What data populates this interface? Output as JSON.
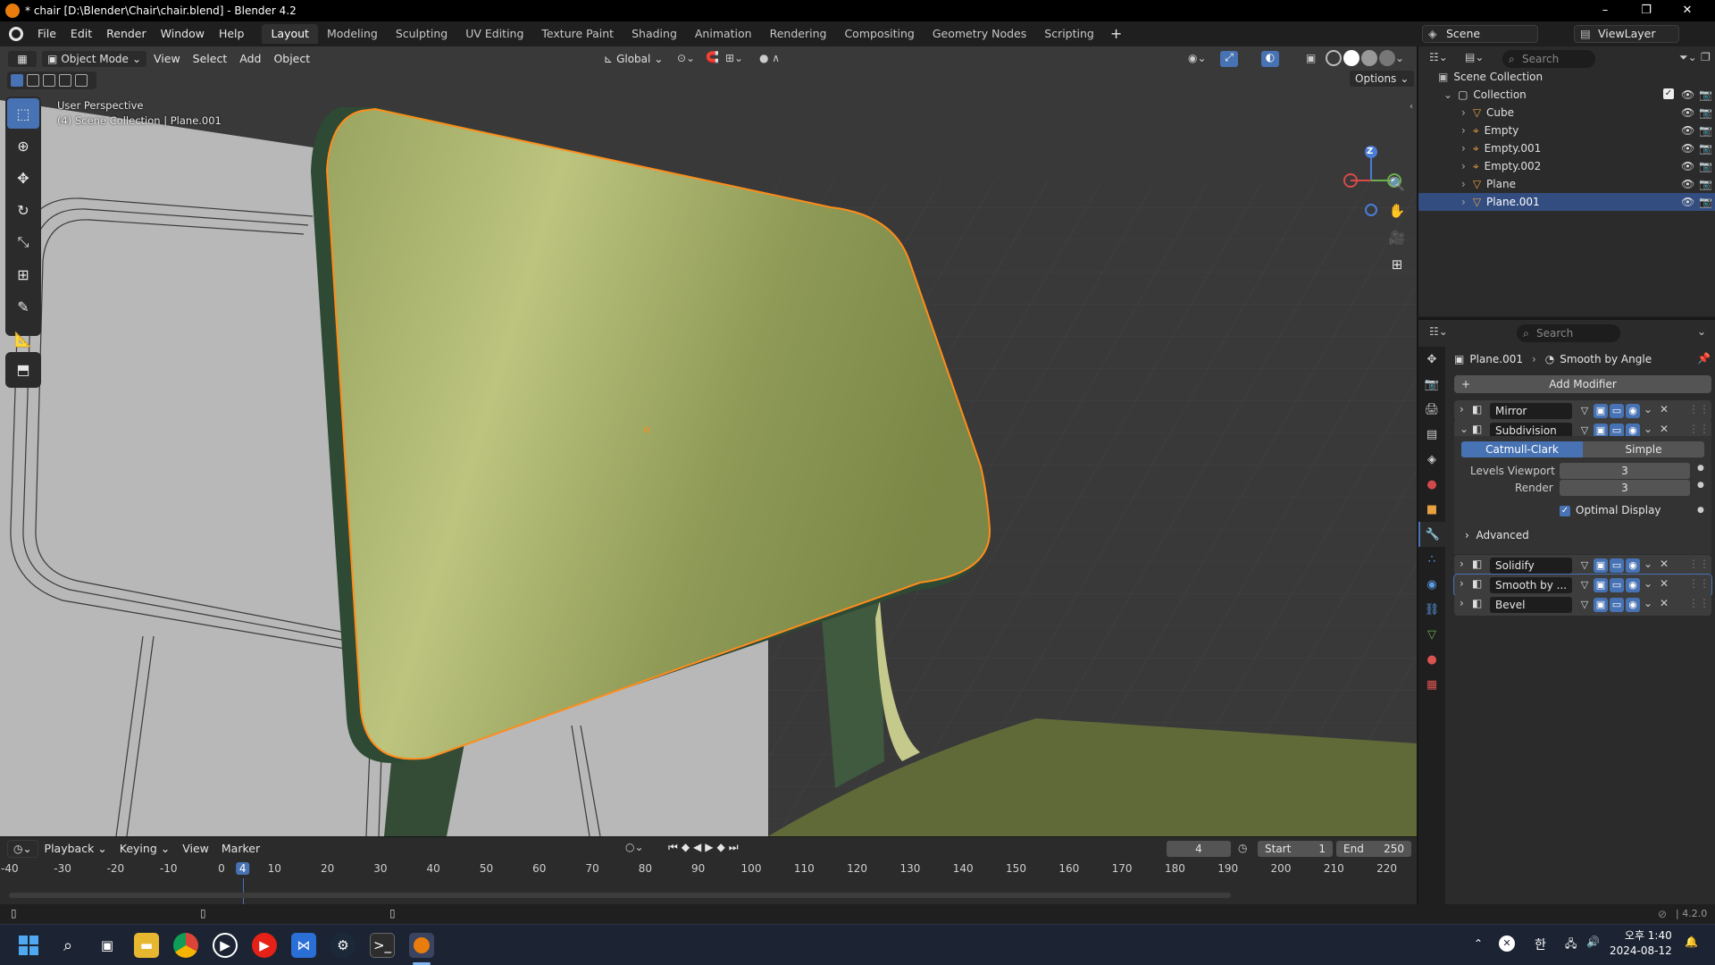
{
  "window": {
    "title": "* chair [D:\\Blender\\Chair\\chair.blend] - Blender 4.2",
    "controls": {
      "minimize": "–",
      "maximize": "❐",
      "close": "✕"
    }
  },
  "menu": [
    "File",
    "Edit",
    "Render",
    "Window",
    "Help"
  ],
  "workspaces": [
    "Layout",
    "Modeling",
    "Sculpting",
    "UV Editing",
    "Texture Paint",
    "Shading",
    "Animation",
    "Rendering",
    "Compositing",
    "Geometry Nodes",
    "Scripting"
  ],
  "active_workspace": "Layout",
  "scene": {
    "name": "Scene",
    "view_layer": "ViewLayer"
  },
  "viewport": {
    "mode": "Object Mode",
    "menus": [
      "View",
      "Select",
      "Add",
      "Object"
    ],
    "orientation": "Global",
    "options_label": "Options",
    "perspective_label": "User Perspective",
    "context_label": "(4) Scene Collection | Plane.001",
    "axis_labels": {
      "z": "Z"
    },
    "tools": [
      "select-box",
      "cursor",
      "move",
      "rotate",
      "scale",
      "transform",
      "annotate",
      "measure",
      "add-cube"
    ],
    "colors": {
      "background": "#393939",
      "seat": "#8c9852",
      "seat_edge": "#ff8c1a",
      "grid": "#4a4a4a"
    }
  },
  "timeline": {
    "menus": [
      "Playback",
      "Keying",
      "View",
      "Marker"
    ],
    "current_frame": "4",
    "start_label": "Start",
    "start": "1",
    "end_label": "End",
    "end": "250",
    "ruler": [
      "-40",
      "-30",
      "-20",
      "-10",
      "0",
      "4",
      "10",
      "20",
      "30",
      "40",
      "50",
      "60",
      "70",
      "80",
      "90",
      "100",
      "110",
      "120",
      "130",
      "140",
      "150",
      "160",
      "170",
      "180",
      "190",
      "200",
      "210",
      "220"
    ]
  },
  "outliner": {
    "search_placeholder": "Search",
    "root": "Scene Collection",
    "collection": "Collection",
    "items": [
      {
        "name": "Cube",
        "type": "mesh"
      },
      {
        "name": "Empty",
        "type": "empty"
      },
      {
        "name": "Empty.001",
        "type": "empty"
      },
      {
        "name": "Empty.002",
        "type": "empty"
      },
      {
        "name": "Plane",
        "type": "mesh"
      },
      {
        "name": "Plane.001",
        "type": "mesh",
        "selected": true
      }
    ]
  },
  "properties": {
    "search_placeholder": "Search",
    "breadcrumb_object": "Plane.001",
    "breadcrumb_modifier": "Smooth by Angle",
    "add_modifier": "Add Modifier",
    "modifiers": [
      {
        "name": "Mirror",
        "expanded": false
      },
      {
        "name": "Subdivision",
        "expanded": true
      },
      {
        "name": "Solidify",
        "expanded": false
      },
      {
        "name": "Smooth by ...",
        "expanded": false,
        "active": true
      },
      {
        "name": "Bevel",
        "expanded": false
      }
    ],
    "subdivision": {
      "type_options": [
        "Catmull-Clark",
        "Simple"
      ],
      "selected_type": "Catmull-Clark",
      "levels_viewport_label": "Levels Viewport",
      "levels_viewport": "3",
      "render_label": "Render",
      "render": "3",
      "optimal_display_label": "Optimal Display",
      "optimal_display": true,
      "advanced_label": "Advanced"
    }
  },
  "statusbar": {
    "version": "4.2.0"
  },
  "taskbar": {
    "apps": [
      "start",
      "search",
      "task-view",
      "file-explorer",
      "chrome",
      "media-player",
      "youtube-music",
      "visual-studio",
      "steam",
      "terminal",
      "blender"
    ],
    "ime_label": "한",
    "time": "오후 1:40",
    "date": "2024-08-12"
  }
}
